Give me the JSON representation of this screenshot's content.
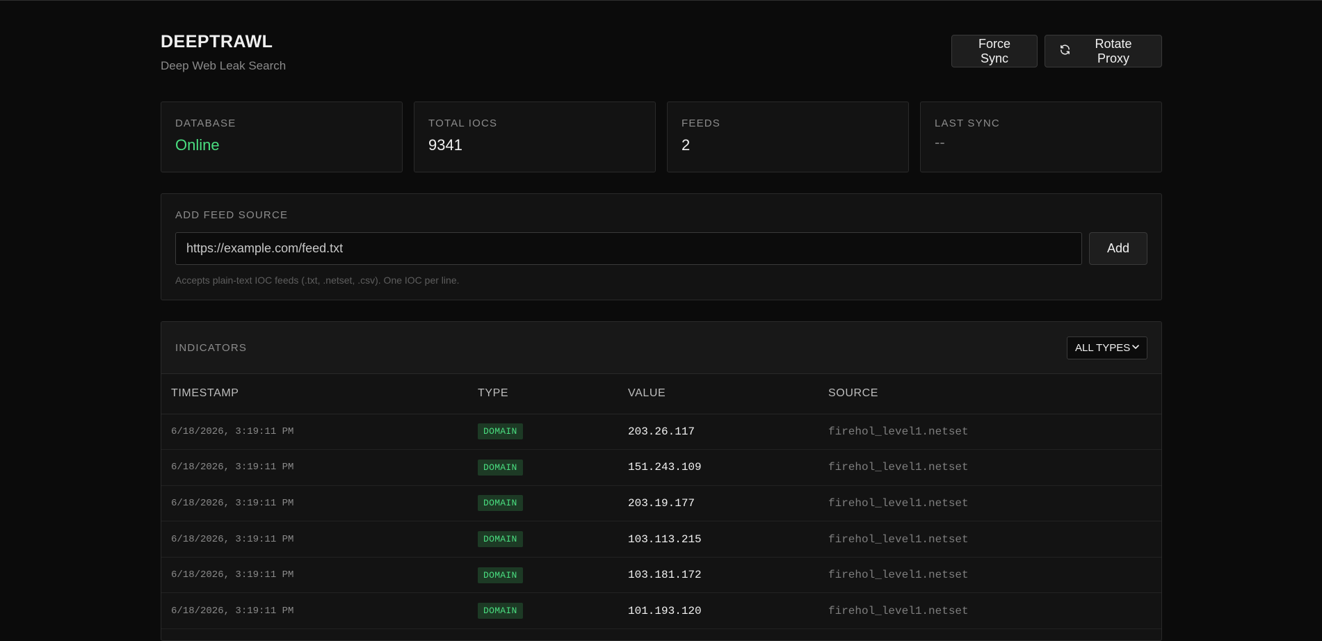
{
  "app": {
    "title": "DEEPTRAWL",
    "subtitle": "Deep Web Leak Search"
  },
  "header": {
    "force_sync_label": "Force Sync",
    "rotate_proxy_label": "Rotate Proxy"
  },
  "stats": [
    {
      "label": "DATABASE",
      "value": "Online"
    },
    {
      "label": "TOTAL IOCS",
      "value": "9341"
    },
    {
      "label": "FEEDS",
      "value": "2"
    },
    {
      "label": "LAST SYNC",
      "value": "--"
    }
  ],
  "feed": {
    "section_label": "ADD FEED SOURCE",
    "input_placeholder": "https://example.com/feed.txt",
    "input_value": "",
    "add_label": "Add",
    "hint": "Accepts plain-text IOC feeds (.txt, .netset, .csv). One IOC per line."
  },
  "indicators": {
    "section_label": "INDICATORS",
    "filter_selected": "ALL TYPES",
    "columns": [
      "TIMESTAMP",
      "TYPE",
      "VALUE",
      "SOURCE"
    ],
    "rows": [
      {
        "timestamp": "6/18/2026, 3:19:11 PM",
        "type": "DOMAIN",
        "value": "203.26.117",
        "source": "firehol_level1.netset"
      },
      {
        "timestamp": "6/18/2026, 3:19:11 PM",
        "type": "DOMAIN",
        "value": "151.243.109",
        "source": "firehol_level1.netset"
      },
      {
        "timestamp": "6/18/2026, 3:19:11 PM",
        "type": "DOMAIN",
        "value": "203.19.177",
        "source": "firehol_level1.netset"
      },
      {
        "timestamp": "6/18/2026, 3:19:11 PM",
        "type": "DOMAIN",
        "value": "103.113.215",
        "source": "firehol_level1.netset"
      },
      {
        "timestamp": "6/18/2026, 3:19:11 PM",
        "type": "DOMAIN",
        "value": "103.181.172",
        "source": "firehol_level1.netset"
      },
      {
        "timestamp": "6/18/2026, 3:19:11 PM",
        "type": "DOMAIN",
        "value": "101.193.120",
        "source": "firehol_level1.netset"
      }
    ]
  },
  "colors": {
    "online": "#4ade80",
    "badge_bg": "#1d3a25",
    "background": "#0b0b0b"
  },
  "icons": {
    "rotate": "refresh-icon",
    "select": "chevron-down-icon"
  }
}
